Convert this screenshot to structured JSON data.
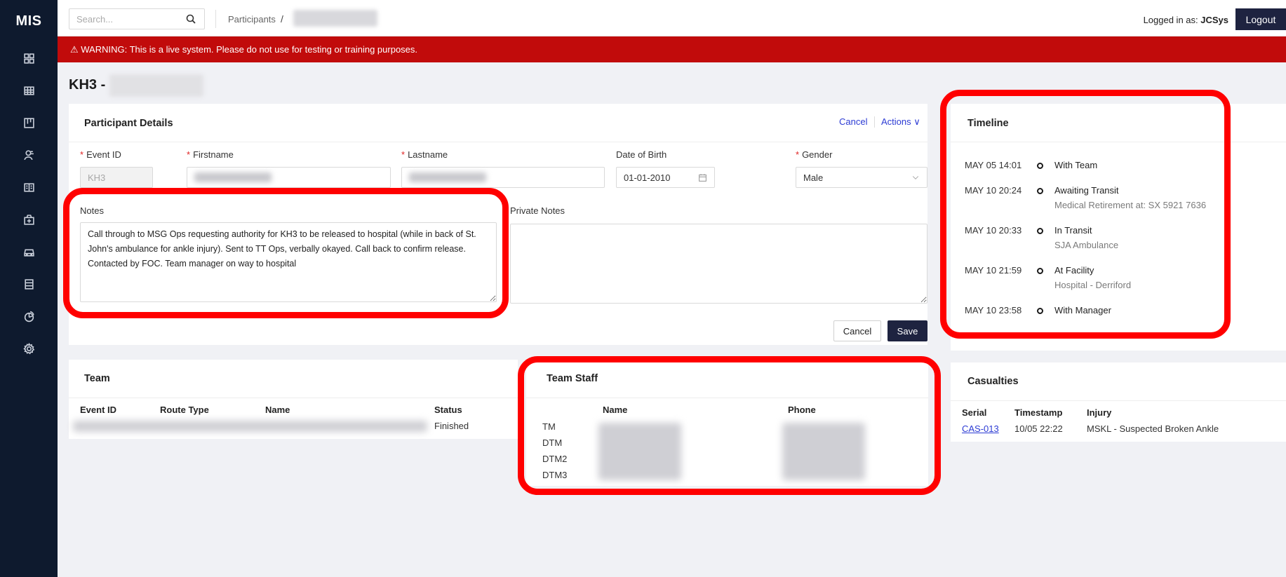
{
  "app": {
    "logo": "MIS"
  },
  "sidebar": {
    "items": [
      {
        "name": "dashboard"
      },
      {
        "name": "table"
      },
      {
        "name": "board"
      },
      {
        "name": "participants"
      },
      {
        "name": "book"
      },
      {
        "name": "medical"
      },
      {
        "name": "vehicles"
      },
      {
        "name": "reports"
      },
      {
        "name": "analytics"
      },
      {
        "name": "settings"
      }
    ]
  },
  "topbar": {
    "search_placeholder": "Search...",
    "breadcrumb": "Participants",
    "breadcrumb_sep": "/",
    "logged_in_label": "Logged in as: ",
    "logged_in_user": "JCSys",
    "logout": "Logout"
  },
  "warning": "⚠ WARNING: This is a live system. Please do not use for testing or training purposes.",
  "page": {
    "title_prefix": "KH3 -"
  },
  "participant": {
    "title": "Participant Details",
    "cancel_link": "Cancel",
    "actions_link": "Actions ∨",
    "fields": {
      "event_id_label": "Event ID",
      "event_id_value": "KH3",
      "firstname_label": "Firstname",
      "lastname_label": "Lastname",
      "dob_label": "Date of Birth",
      "dob_value": "01-01-2010",
      "gender_label": "Gender",
      "gender_value": "Male",
      "notes_label": "Notes",
      "notes_value": "Call through to MSG Ops requesting authority for KH3 to be released to hospital (while in back of St. John's ambulance for ankle injury). Sent to TT Ops, verbally okayed. Call back to confirm release.\nContacted by FOC. Team manager on way to hospital",
      "private_notes_label": "Private Notes",
      "private_notes_value": ""
    },
    "cancel_button": "Cancel",
    "save_button": "Save"
  },
  "timeline": {
    "title": "Timeline",
    "entries": [
      {
        "time": "MAY 05 14:01",
        "label": "With Team",
        "sub": ""
      },
      {
        "time": "MAY 10 20:24",
        "label": "Awaiting Transit",
        "sub": "Medical Retirement at: SX 5921 7636"
      },
      {
        "time": "MAY 10 20:33",
        "label": "In Transit",
        "sub": "SJA Ambulance"
      },
      {
        "time": "MAY 10 21:59",
        "label": "At Facility",
        "sub": "Hospital - Derriford"
      },
      {
        "time": "MAY 10 23:58",
        "label": "With Manager",
        "sub": ""
      }
    ]
  },
  "team": {
    "title": "Team",
    "columns": [
      "Event ID",
      "Route Type",
      "Name",
      "Status"
    ],
    "row_status": "Finished"
  },
  "team_staff": {
    "title": "Team Staff",
    "columns": [
      "Name",
      "Phone"
    ],
    "roles": [
      "TM",
      "DTM",
      "DTM2",
      "DTM3"
    ]
  },
  "casualties": {
    "title": "Casualties",
    "columns": [
      "Serial",
      "Timestamp",
      "Injury"
    ],
    "rows": [
      {
        "serial": "CAS-013",
        "timestamp": "10/05 22:22",
        "injury": "MSKL - Suspected Broken Ankle"
      }
    ]
  },
  "colors": {
    "sidebar": "#0e1a2e",
    "warning": "#c10b0b",
    "highlight": "#ff0000",
    "primary": "#1e2340",
    "link": "#2c3bd4"
  }
}
